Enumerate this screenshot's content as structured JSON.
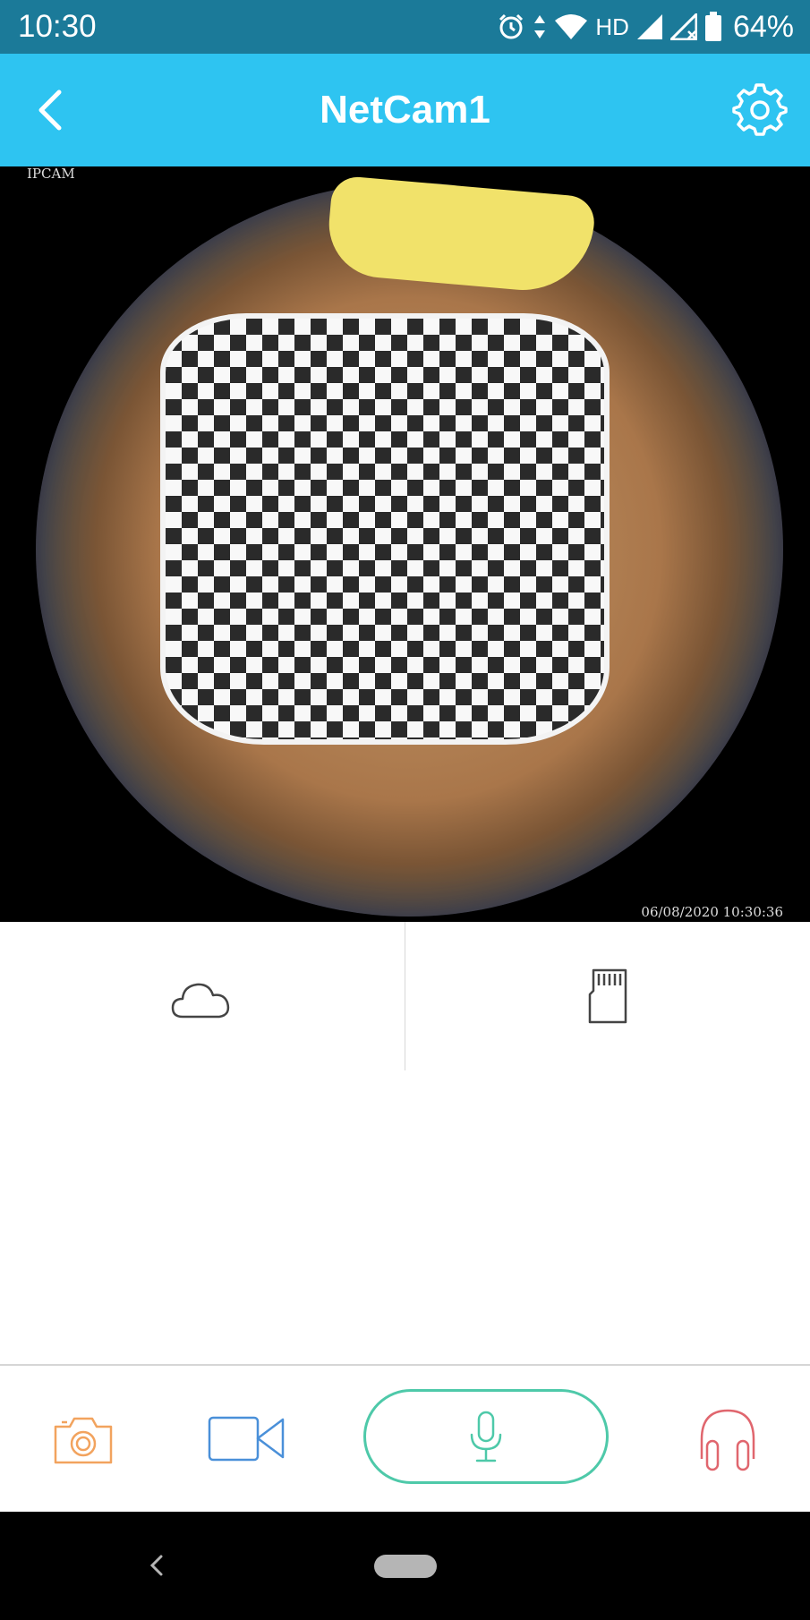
{
  "status_bar": {
    "time": "10:30",
    "network_label": "HD",
    "battery_percent": "64%",
    "icons": [
      "alarm-icon",
      "data-arrows-icon",
      "wifi-icon",
      "signal-icon",
      "signal-no-data-icon",
      "battery-icon"
    ]
  },
  "app_bar": {
    "title": "NetCam1",
    "back_icon": "chevron-left-icon",
    "settings_icon": "gear-icon",
    "background": "#2ec4f1"
  },
  "camera_feed": {
    "overlay_label": "IPCAM",
    "timestamp": "06/08/2020 10:30:36"
  },
  "storage_options": [
    {
      "icon": "cloud-icon"
    },
    {
      "icon": "sd-card-icon"
    }
  ],
  "toolbar": {
    "items": [
      {
        "icon": "camera-icon",
        "color": "#f2a35e"
      },
      {
        "icon": "video-camera-icon",
        "color": "#4a90d9"
      },
      {
        "icon": "microphone-icon",
        "color": "#4ec9a9"
      },
      {
        "icon": "headphones-icon",
        "color": "#e0666e"
      }
    ]
  },
  "nav_bar": {
    "icons": [
      "back-icon",
      "home-pill-icon"
    ]
  }
}
